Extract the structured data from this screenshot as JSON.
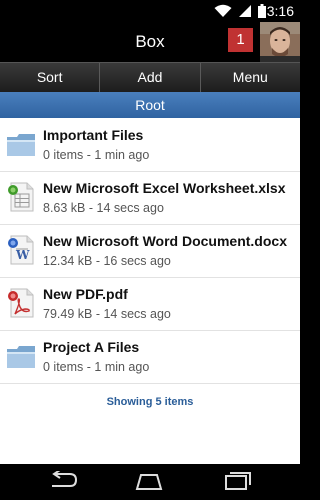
{
  "status_bar": {
    "time": "3:16",
    "icons": [
      "wifi-icon",
      "signal-icon",
      "battery-icon"
    ]
  },
  "app_bar": {
    "title": "Box",
    "notification_count": "1"
  },
  "toolbar": {
    "sort_label": "Sort",
    "add_label": "Add",
    "menu_label": "Menu"
  },
  "breadcrumb": {
    "label": "Root"
  },
  "files": [
    {
      "name": "Important Files",
      "meta": "0 items - 1 min ago",
      "icon": "folder-icon"
    },
    {
      "name": "New Microsoft Excel Worksheet.xlsx",
      "meta": "8.63 kB - 14 secs ago",
      "icon": "excel-file-icon"
    },
    {
      "name": "New Microsoft Word Document.docx",
      "meta": "12.34 kB - 16 secs ago",
      "icon": "word-file-icon"
    },
    {
      "name": "New PDF.pdf",
      "meta": "79.49 kB - 14 secs ago",
      "icon": "pdf-file-icon"
    },
    {
      "name": "Project A Files",
      "meta": "0 items - 1 min ago",
      "icon": "folder-icon"
    }
  ],
  "footer": {
    "showing_text": "Showing 5 items"
  },
  "nav_bar": {
    "buttons": [
      "back-icon",
      "home-icon",
      "recent-apps-icon"
    ]
  },
  "colors": {
    "accent_blue": "#2f63a1",
    "badge_red": "#c03232",
    "link_blue": "#2a5d98"
  }
}
